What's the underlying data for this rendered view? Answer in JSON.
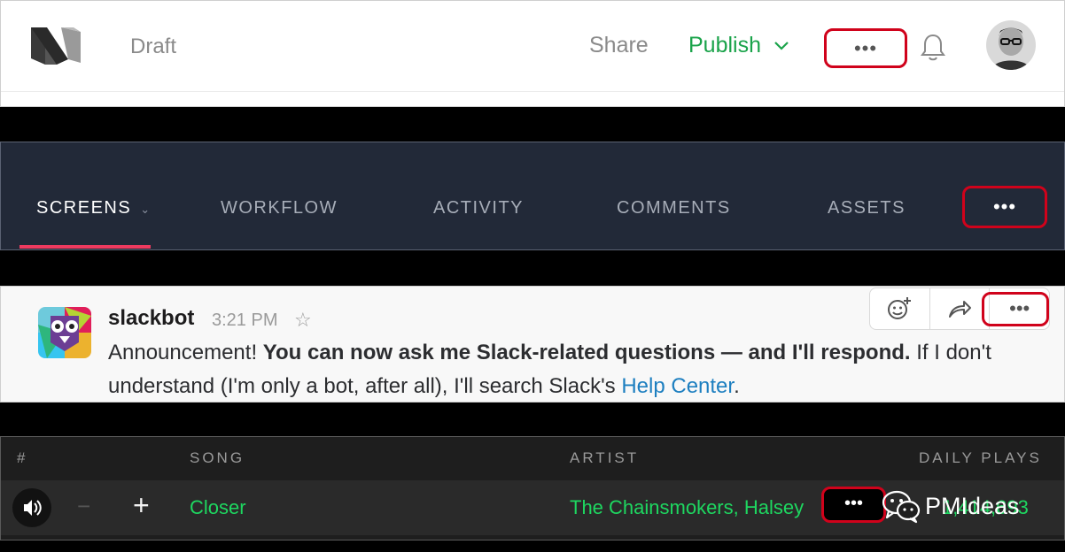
{
  "medium": {
    "draft_label": "Draft",
    "share_label": "Share",
    "publish_label": "Publish",
    "more_label": "•••",
    "icons": {
      "logo": "medium-logo",
      "chevron": "chevron-down-icon",
      "bell": "bell-icon",
      "avatar": "avatar"
    },
    "colors": {
      "publish": "#1aa34a",
      "muted": "#8a8a8a",
      "highlight": "#d0021b"
    }
  },
  "invision": {
    "tabs": [
      {
        "label": "SCREENS",
        "active": true
      },
      {
        "label": "WORKFLOW"
      },
      {
        "label": "ACTIVITY"
      },
      {
        "label": "COMMENTS"
      },
      {
        "label": "ASSETS"
      }
    ],
    "more_label": "•••",
    "colors": {
      "background": "#222938",
      "underline": "#ee3a5f"
    }
  },
  "slack": {
    "username": "slackbot",
    "time": "3:21 PM",
    "message": {
      "lead": "Announcement! ",
      "bold": "You can now ask me Slack-related questions — and I'll respond.",
      "rest": " If I don't understand (I'm only a bot, after all), I'll search Slack's ",
      "link": "Help Center",
      "end": "."
    },
    "actions": [
      {
        "icon": "add-reaction-icon"
      },
      {
        "icon": "share-arrow-icon"
      },
      {
        "icon": "more-icon",
        "label": "•••"
      }
    ],
    "colors": {
      "link": "#1d7fc0"
    }
  },
  "spotify": {
    "headers": {
      "index": "#",
      "song": "SONG",
      "artist": "ARTIST",
      "plays": "DAILY  PLAYS"
    },
    "row": {
      "song": "Closer",
      "artist": "The Chainsmokers, Halsey",
      "plays": "1,414,693"
    },
    "minus_label": "−",
    "plus_label": "+",
    "more_label": "•••",
    "colors": {
      "accent": "#1ed760"
    }
  },
  "watermark": {
    "text": "PMIdeas",
    "icon": "wechat-icon"
  }
}
